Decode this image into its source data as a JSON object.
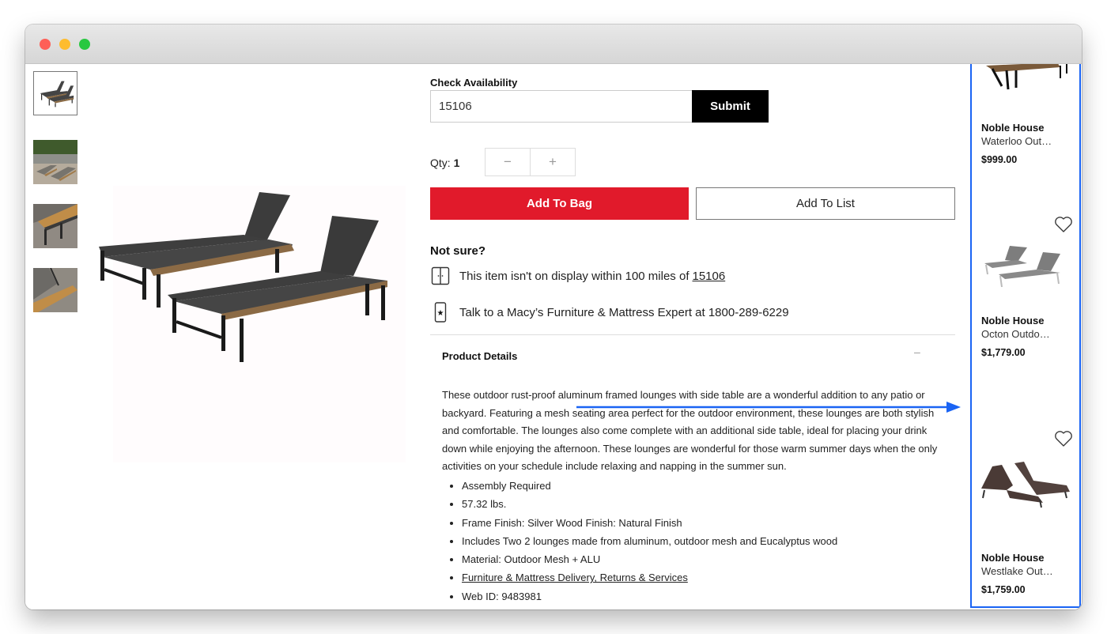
{
  "window": {
    "controls": [
      "close",
      "minimize",
      "maximize"
    ]
  },
  "gallery": {
    "thumbnails": [
      {
        "alt": "Two black lounges with wood side table",
        "active": true
      },
      {
        "alt": "Lounges on patio lifestyle photo",
        "active": false
      },
      {
        "alt": "Wood side table close-up",
        "active": false
      },
      {
        "alt": "Mesh seat and wood table detail",
        "active": false
      }
    ],
    "main_image_alt": "Two black mesh outdoor chaise lounges with eucalyptus wood side tables"
  },
  "availability": {
    "label": "Check Availability",
    "zip_value": "15106",
    "submit_label": "Submit"
  },
  "quantity": {
    "label": "Qty:",
    "value": "1",
    "decrement": "−",
    "increment": "+"
  },
  "actions": {
    "add_to_bag": "Add To Bag",
    "add_to_list": "Add To List"
  },
  "not_sure": {
    "title": "Not sure?",
    "display_text": "This item isn't on display within 100 miles of ",
    "display_zip": "15106",
    "expert_text": "Talk to a Macy’s Furniture & Mattress Expert at 1800-289-6229"
  },
  "product_details": {
    "title": "Product Details",
    "toggle": "–",
    "description": "These outdoor rust-proof aluminum framed lounges with side table are a wonderful addition to any patio or backyard. Featuring a mesh seating area perfect for the outdoor environment, these lounges are both stylish and comfortable. The lounges also come complete with an additional side table, ideal for placing your drink down while enjoying the afternoon. These lounges are wonderful for those warm summer days when the only activities on your schedule include relaxing and napping in the summer sun.",
    "bullets": [
      "Assembly Required",
      "57.32 lbs.",
      "Frame Finish: Silver Wood Finish: Natural Finish",
      "Includes Two 2 lounges made from aluminum, outdoor mesh and Eucalyptus wood",
      "Material: Outdoor Mesh + ALU",
      "Furniture & Mattress Delivery, Returns & Services",
      "Web ID: 9483981"
    ]
  },
  "recommendations": [
    {
      "brand": "Noble House",
      "name": "Waterloo Out…",
      "price": "$999.00"
    },
    {
      "brand": "Noble House",
      "name": "Octon Outdo…",
      "price": "$1,779.00"
    },
    {
      "brand": "Noble House",
      "name": "Westlake Out…",
      "price": "$1,759.00"
    }
  ],
  "colors": {
    "accent_red": "#e11a2b",
    "annotation_blue": "#1a64f4",
    "submit_black": "#000000"
  }
}
